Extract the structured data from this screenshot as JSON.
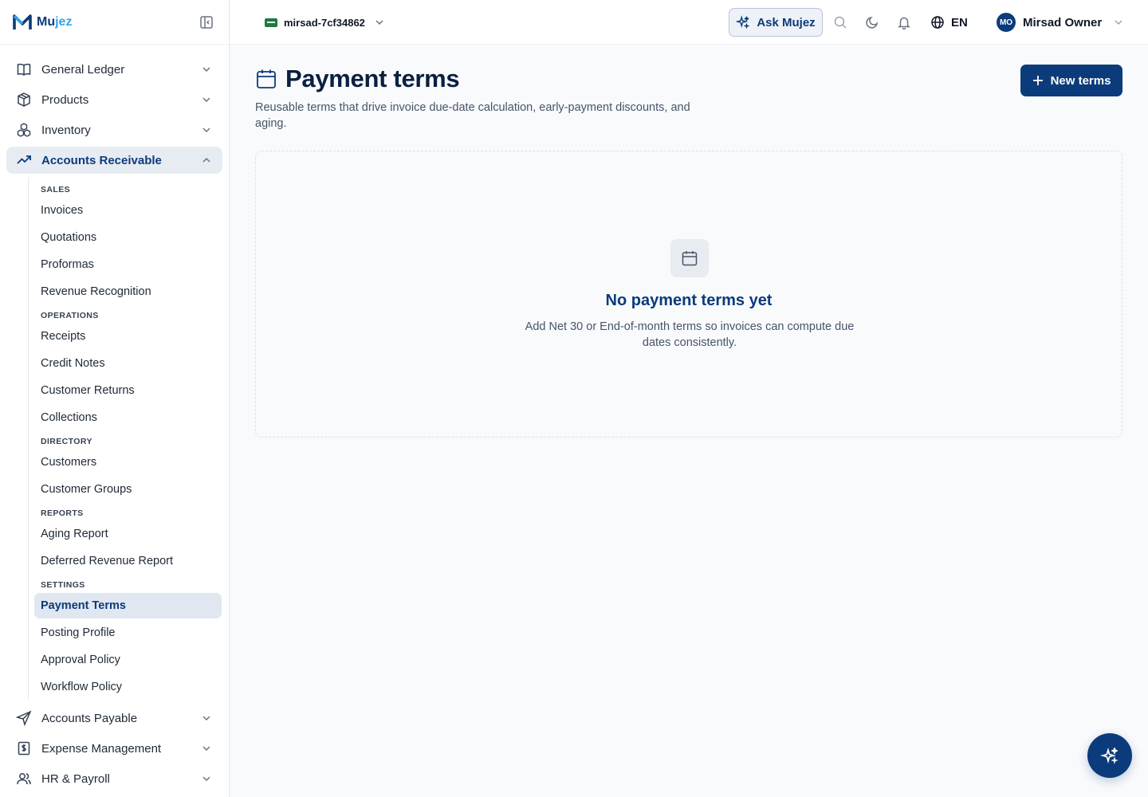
{
  "brand": {
    "name_main": "Mu",
    "name_accent": "jez"
  },
  "sidebar": {
    "top_items": [
      {
        "label": "General Ledger",
        "icon": "book-icon"
      },
      {
        "label": "Products",
        "icon": "box-icon"
      },
      {
        "label": "Inventory",
        "icon": "boxes-icon"
      },
      {
        "label": "Accounts Receivable",
        "icon": "trend-up-icon",
        "active": true
      }
    ],
    "ar_sections": {
      "sales": {
        "heading": "SALES",
        "items": [
          "Invoices",
          "Quotations",
          "Proformas",
          "Revenue Recognition"
        ]
      },
      "operations": {
        "heading": "OPERATIONS",
        "items": [
          "Receipts",
          "Credit Notes",
          "Customer Returns",
          "Collections"
        ]
      },
      "directory": {
        "heading": "DIRECTORY",
        "items": [
          "Customers",
          "Customer Groups"
        ]
      },
      "reports": {
        "heading": "REPORTS",
        "items": [
          "Aging Report",
          "Deferred Revenue Report"
        ]
      },
      "settings": {
        "heading": "SETTINGS",
        "items": [
          "Payment Terms",
          "Posting Profile",
          "Approval Policy",
          "Workflow Policy"
        ],
        "active": "Payment Terms"
      }
    },
    "bottom_items": [
      {
        "label": "Accounts Payable",
        "icon": "send-icon"
      },
      {
        "label": "Expense Management",
        "icon": "receipt-dollar-icon"
      },
      {
        "label": "HR & Payroll",
        "icon": "users-icon"
      }
    ]
  },
  "header": {
    "org_name": "mirsad-7cf34862",
    "ask_label": "Ask Mujez",
    "language": "EN",
    "user_initials": "MO",
    "user_name": "Mirsad Owner"
  },
  "page": {
    "title": "Payment terms",
    "description": "Reusable terms that drive invoice due-date calculation, early-payment discounts, and aging.",
    "new_button": "New terms",
    "empty_title": "No payment terms yet",
    "empty_description": "Add Net 30 or End-of-month terms so invoices can compute due dates consistently."
  },
  "colors": {
    "brand": "#0b3b7a",
    "accent": "#2fa4e7",
    "active_bg": "#e7ecf3"
  }
}
